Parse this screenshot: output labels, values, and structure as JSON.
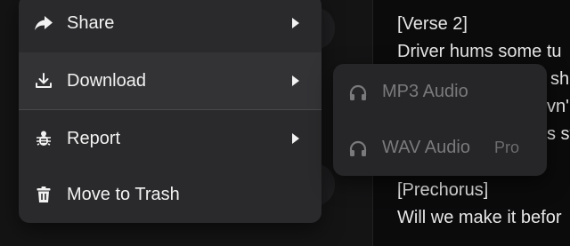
{
  "lyrics": {
    "lines": [
      "[Verse 2]",
      "Driver hums some tu",
      "",
      "",
      "",
      "",
      "[Prechorus]",
      "Will we make it befor"
    ],
    "peek_fragments": [
      "sha",
      "vn'",
      "s st"
    ]
  },
  "menu": {
    "items": [
      {
        "label": "Share",
        "icon": "share-icon",
        "has_submenu": true
      },
      {
        "label": "Download",
        "icon": "download-icon",
        "has_submenu": true,
        "active": true
      },
      {
        "label": "Report",
        "icon": "bug-icon",
        "has_submenu": true
      },
      {
        "label": "Move to Trash",
        "icon": "trash-icon",
        "has_submenu": false
      }
    ]
  },
  "submenu": {
    "items": [
      {
        "label": "MP3 Audio",
        "icon": "headphones-icon",
        "badge": ""
      },
      {
        "label": "WAV Audio",
        "icon": "headphones-icon",
        "badge": "Pro"
      }
    ]
  },
  "colors": {
    "menu_bg": "#2a2a2c",
    "menu_active_bg": "#333336",
    "submenu_bg": "#262628",
    "text": "#f2f2f2",
    "disabled_text": "#7a7a7d"
  }
}
